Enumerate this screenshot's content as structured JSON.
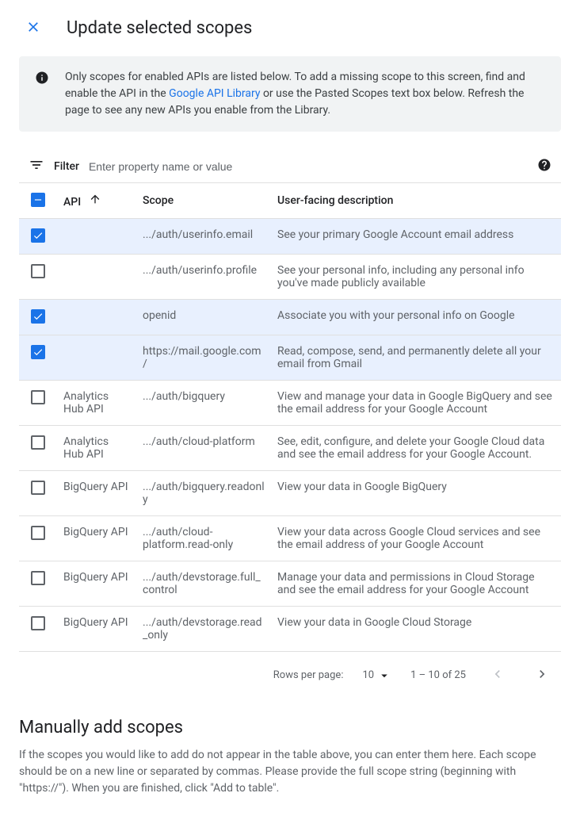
{
  "header": {
    "title": "Update selected scopes"
  },
  "info": {
    "text_before": "Only scopes for enabled APIs are listed below. To add a missing scope to this screen, find and enable the API in the ",
    "link_text": "Google API Library",
    "text_after": " or use the Pasted Scopes text box below. Refresh the page to see any new APIs you enable from the Library."
  },
  "filter": {
    "label": "Filter",
    "placeholder": "Enter property name or value"
  },
  "table": {
    "columns": {
      "api": "API",
      "scope": "Scope",
      "desc": "User-facing description"
    },
    "rows": [
      {
        "checked": true,
        "api": "",
        "scope": ".../auth/userinfo.email",
        "desc": "See your primary Google Account email address"
      },
      {
        "checked": false,
        "api": "",
        "scope": ".../auth/userinfo.profile",
        "desc": "See your personal info, including any personal info you've made publicly available"
      },
      {
        "checked": true,
        "api": "",
        "scope": "openid",
        "desc": "Associate you with your personal info on Google"
      },
      {
        "checked": true,
        "api": "",
        "scope": "https://mail.google.com/",
        "desc": "Read, compose, send, and permanently delete all your email from Gmail"
      },
      {
        "checked": false,
        "api": "Analytics Hub API",
        "scope": ".../auth/bigquery",
        "desc": "View and manage your data in Google BigQuery and see the email address for your Google Account"
      },
      {
        "checked": false,
        "api": "Analytics Hub API",
        "scope": ".../auth/cloud-platform",
        "desc": "See, edit, configure, and delete your Google Cloud data and see the email address for your Google Account."
      },
      {
        "checked": false,
        "api": "BigQuery API",
        "scope": ".../auth/bigquery.readonly",
        "desc": "View your data in Google BigQuery"
      },
      {
        "checked": false,
        "api": "BigQuery API",
        "scope": ".../auth/cloud-platform.read-only",
        "desc": "View your data across Google Cloud services and see the email address of your Google Account"
      },
      {
        "checked": false,
        "api": "BigQuery API",
        "scope": ".../auth/devstorage.full_control",
        "desc": "Manage your data and permissions in Cloud Storage and see the email address for your Google Account"
      },
      {
        "checked": false,
        "api": "BigQuery API",
        "scope": ".../auth/devstorage.read_only",
        "desc": "View your data in Google Cloud Storage"
      }
    ]
  },
  "pagination": {
    "rows_label": "Rows per page:",
    "rows_value": "10",
    "range": "1 – 10 of 25"
  },
  "manual": {
    "title": "Manually add scopes",
    "text": "If the scopes you would like to add do not appear in the table above, you can enter them here. Each scope should be on a new line or separated by commas. Please provide the full scope string (beginning with \"https://\"). When you are finished, click \"Add to table\"."
  }
}
